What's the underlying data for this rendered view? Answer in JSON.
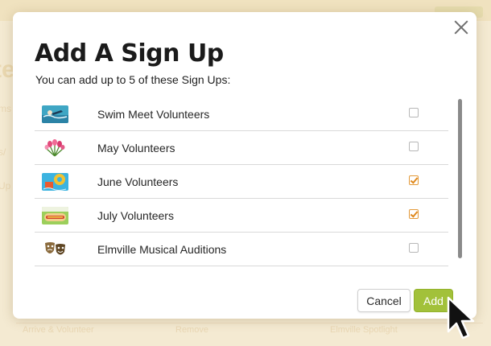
{
  "background": {
    "big_text": "te",
    "fragments": [
      "ms",
      "s/",
      "Up",
      "Arrive & Volunteer",
      "Remove",
      "Elmville Spotlight"
    ]
  },
  "modal": {
    "title": "Add A Sign Up",
    "subtitle": "You can add up to 5 of these Sign Ups:",
    "close_icon": "close-icon",
    "items": [
      {
        "label": "Swim Meet Volunteers",
        "checked": false,
        "icon": "swimmer-thumbnail"
      },
      {
        "label": "May Volunteers",
        "checked": false,
        "icon": "tulips-thumbnail"
      },
      {
        "label": "June Volunteers",
        "checked": true,
        "icon": "pool-float-thumbnail"
      },
      {
        "label": "July Volunteers",
        "checked": true,
        "icon": "picnic-thumbnail"
      },
      {
        "label": "Elmville Musical Auditions",
        "checked": false,
        "icon": "theater-masks-thumbnail"
      }
    ],
    "buttons": {
      "cancel": "Cancel",
      "add": "Add"
    }
  },
  "colors": {
    "accent_green": "#a2c13a",
    "check_orange": "#e0891d",
    "backdrop": "#f6ecd4"
  },
  "pointer": "mouse-pointer-icon"
}
